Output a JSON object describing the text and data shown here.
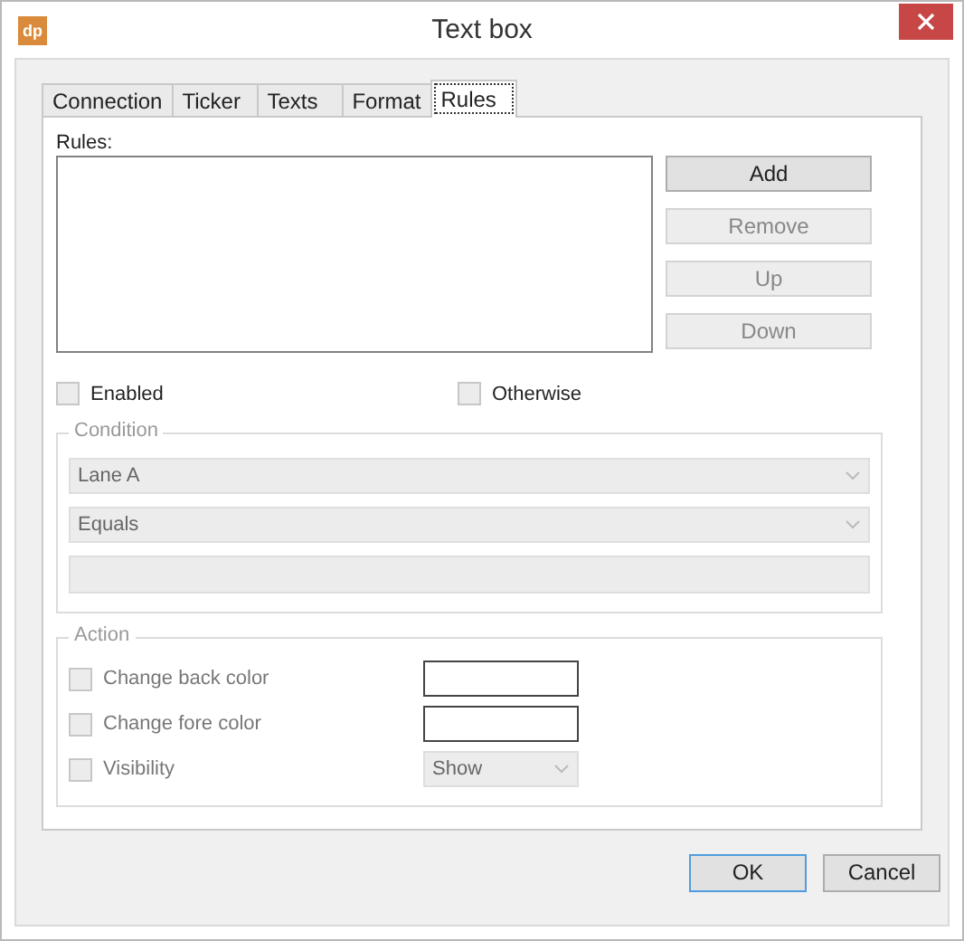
{
  "window": {
    "title": "Text box",
    "logo": "dp"
  },
  "tabs": [
    {
      "label": "Connection",
      "selected": false
    },
    {
      "label": "Ticker",
      "selected": false
    },
    {
      "label": "Texts",
      "selected": false
    },
    {
      "label": "Format",
      "selected": false
    },
    {
      "label": "Rules",
      "selected": true
    }
  ],
  "rules_label": "Rules:",
  "rule_buttons": [
    {
      "label": "Add",
      "disabled": false
    },
    {
      "label": "Remove",
      "disabled": true
    },
    {
      "label": "Up",
      "disabled": true
    },
    {
      "label": "Down",
      "disabled": true
    }
  ],
  "options": [
    {
      "label": "Enabled",
      "checked": false
    },
    {
      "label": "Otherwise",
      "checked": false
    }
  ],
  "condition": {
    "title": "Condition",
    "disabled": true,
    "fields": [
      {
        "kind": "dropdown",
        "value": "Lane A"
      },
      {
        "kind": "dropdown",
        "value": "Equals"
      },
      {
        "kind": "text"
      }
    ]
  },
  "action": {
    "title": "Action",
    "disabled": true,
    "rows": [
      {
        "label": "Change back color",
        "checked": false,
        "kind": "color"
      },
      {
        "label": "Change fore color",
        "checked": false,
        "kind": "color"
      },
      {
        "label": "Visibility",
        "checked": false,
        "kind": "dropdown",
        "value": "Show"
      }
    ]
  },
  "buttons": [
    {
      "label": "OK",
      "default": true
    },
    {
      "label": "Cancel",
      "default": false
    }
  ]
}
